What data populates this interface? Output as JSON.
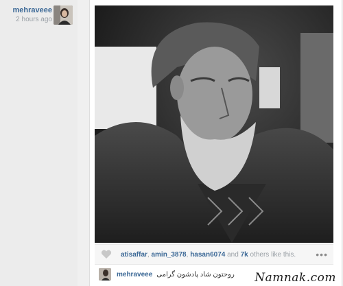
{
  "post": {
    "author": "mehraveee",
    "time_ago": "2 hours ago"
  },
  "likes": {
    "users": [
      "atisaffar",
      "amin_3878",
      "hasan6074"
    ],
    "and_text": "and",
    "others_count": "7k",
    "others_suffix": "others like this."
  },
  "comment": {
    "user": "mehraveee",
    "text": "روحتون شاد پادشون گرامی"
  },
  "watermark": "Namnak.com",
  "icons": {
    "like": "heart-icon",
    "more": "ellipsis-icon"
  },
  "colors": {
    "username": "#3b6896",
    "meta": "#9aa0a6"
  }
}
